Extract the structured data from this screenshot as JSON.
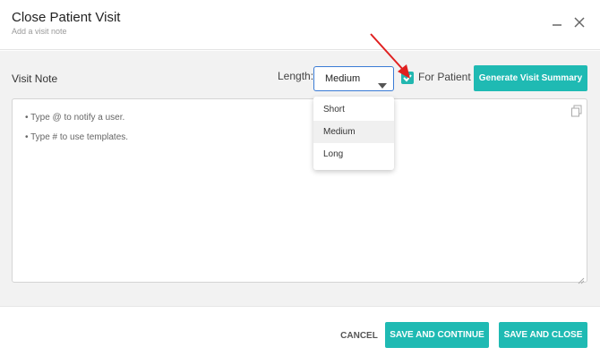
{
  "header": {
    "title": "Close Patient Visit",
    "subtitle": "Add a visit note",
    "minimize_icon": "minimize-icon",
    "close_icon": "close-icon"
  },
  "note": {
    "section_label": "Visit Note",
    "length_label": "Length:",
    "length_value": "Medium",
    "length_options": [
      "Short",
      "Medium",
      "Long"
    ],
    "for_patient_label": "For Patient",
    "for_patient_checked": true,
    "generate_button": "Generate Visit Summary",
    "hints": [
      "• Type @ to notify a user.",
      "• Type # to use templates."
    ]
  },
  "footer": {
    "cancel_label": "CANCEL",
    "save_continue_label": "SAVE AND CONTINUE",
    "save_close_label": "SAVE AND CLOSE"
  },
  "colors": {
    "accent": "#1fbab3",
    "select_border": "#3a7bd5",
    "annotation_arrow": "#e02020"
  }
}
